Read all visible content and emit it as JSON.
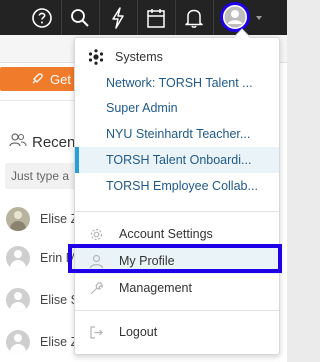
{
  "topbar": {
    "icons": [
      "help-icon",
      "search-icon",
      "lightning-icon",
      "calendar-icon",
      "bell-icon",
      "user-avatar-icon"
    ]
  },
  "background": {
    "get_button_label": "Get",
    "recent_label": "Recen",
    "search_placeholder": "Just type a",
    "users": [
      {
        "name": "Elise Z",
        "photo": true
      },
      {
        "name": "Erin M",
        "photo": false
      },
      {
        "name": "Elise S",
        "photo": false
      },
      {
        "name": "Elise Z",
        "photo": false
      }
    ]
  },
  "dropdown": {
    "systems_label": "Systems",
    "systems": [
      {
        "label": "Network: TORSH Talent ...",
        "selected": false
      },
      {
        "label": "Super Admin",
        "selected": false
      },
      {
        "label": "NYU Steinhardt Teacher...",
        "selected": false
      },
      {
        "label": "TORSH Talent Onboardi...",
        "selected": true
      },
      {
        "label": "TORSH Employee Collab...",
        "selected": false
      }
    ],
    "account_settings": "Account Settings",
    "my_profile": "My Profile",
    "management": "Management",
    "logout": "Logout"
  },
  "colors": {
    "topbar": "#232323",
    "link": "#1f5a8a",
    "selected_accent": "#26a0d6",
    "highlight_box": "#1f00e6",
    "orange_button": "#f07b2a"
  }
}
